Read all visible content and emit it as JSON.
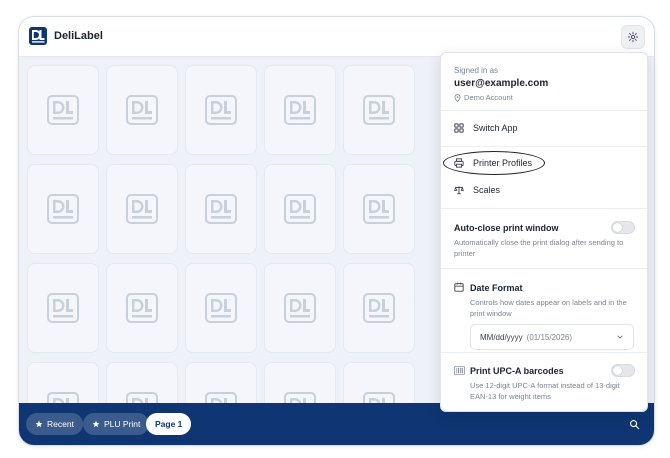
{
  "app": {
    "title": "DeliLabel",
    "logo_text": "DL"
  },
  "account": {
    "signed_in_label": "Signed in as",
    "email": "user@example.com",
    "account_type": "Demo Account"
  },
  "menu": {
    "switch_app": "Switch App",
    "printer_profiles": "Printer Profiles",
    "scales": "Scales"
  },
  "settings": {
    "auto_close": {
      "title": "Auto-close print window",
      "description": "Automatically close the print dialog after sending to printer",
      "enabled": false
    },
    "date_format": {
      "title": "Date Format",
      "description": "Controls how dates appear on labels and in the print window",
      "selected": "MM/dd/yyyy",
      "example": "(01/15/2026)"
    },
    "upc_a": {
      "title": "Print UPC-A barcodes",
      "description": "Use 12-digit UPC-A format instead of 13-digit EAN-13 for weight items",
      "enabled": false
    }
  },
  "bottom_nav": {
    "recent": "Recent",
    "plu_print": "PLU Print",
    "page1": "Page 1"
  },
  "colors": {
    "brand_navy": "#0f3672",
    "tile_bg": "#f4f6fb",
    "grid_bg": "#eef2f8"
  },
  "icons": {
    "settings": "gear-icon",
    "search": "search-icon",
    "switch_app": "grid-icon",
    "printer": "printer-icon",
    "scales": "scale-icon",
    "location": "location-pin-icon",
    "calendar": "calendar-icon",
    "barcode": "barcode-icon",
    "star": "star-icon",
    "chevron": "chevron-down-icon"
  }
}
